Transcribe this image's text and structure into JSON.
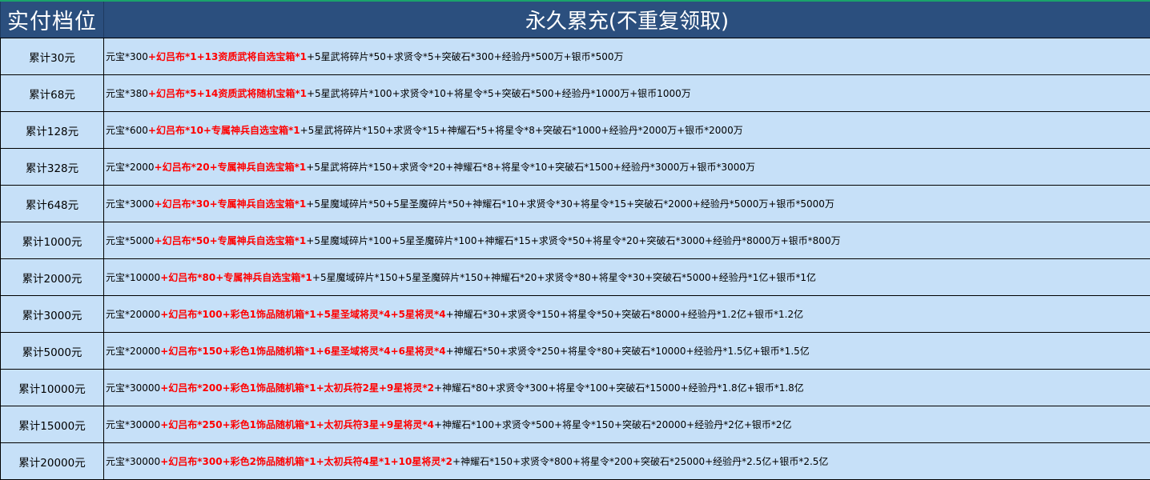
{
  "header": {
    "col_tier": "实付档位",
    "col_rewards": "永久累充(不重复领取)"
  },
  "rows": [
    {
      "tier": "累计30元",
      "base": "元宝*300",
      "highlight": "+幻吕布*1+13资质武将自选宝箱*1",
      "rest": "+5星武将碎片*50+求贤令*5+突破石*300+经验丹*500万+银币*500万"
    },
    {
      "tier": "累计68元",
      "base": "元宝*380",
      "highlight": "+幻吕布*5+14资质武将随机宝箱*1",
      "rest": "+5星武将碎片*100+求贤令*10+将星令*5+突破石*500+经验丹*1000万+银币1000万"
    },
    {
      "tier": "累计128元",
      "base": "元宝*600",
      "highlight": "+幻吕布*10+专属神兵自选宝箱*1",
      "rest": "+5星武将碎片*150+求贤令*15+神耀石*5+将星令*8+突破石*1000+经验丹*2000万+银币*2000万"
    },
    {
      "tier": "累计328元",
      "base": "元宝*2000",
      "highlight": "+幻吕布*20+专属神兵自选宝箱*1",
      "rest": "+5星武将碎片*150+求贤令*20+神耀石*8+将星令*10+突破石*1500+经验丹*3000万+银币*3000万"
    },
    {
      "tier": "累计648元",
      "base": "元宝*3000",
      "highlight": "+幻吕布*30+专属神兵自选宝箱*1",
      "rest": "+5星魔域碎片*50+5星圣魔碎片*50+神耀石*10+求贤令*30+将星令*15+突破石*2000+经验丹*5000万+银币*5000万"
    },
    {
      "tier": "累计1000元",
      "base": "元宝*5000",
      "highlight": "+幻吕布*50+专属神兵自选宝箱*1",
      "rest": "+5星魔域碎片*100+5星圣魔碎片*100+神耀石*15+求贤令*50+将星令*20+突破石*3000+经验丹*8000万+银币*800万"
    },
    {
      "tier": "累计2000元",
      "base": "元宝*10000",
      "highlight": "+幻吕布*80+专属神兵自选宝箱*1",
      "rest": "+5星魔域碎片*150+5星圣魔碎片*150+神耀石*20+求贤令*80+将星令*30+突破石*5000+经验丹*1亿+银币*1亿"
    },
    {
      "tier": "累计3000元",
      "base": "元宝*20000",
      "highlight": "+幻吕布*100+彩色1饰品随机箱*1+5星圣域将灵*4+5星将灵*4",
      "rest": "+神耀石*30+求贤令*150+将星令*50+突破石*8000+经验丹*1.2亿+银币*1.2亿"
    },
    {
      "tier": "累计5000元",
      "base": "元宝*20000",
      "highlight": "+幻吕布*150+彩色1饰品随机箱*1+6星圣域将灵*4+6星将灵*4",
      "rest": "+神耀石*50+求贤令*250+将星令*80+突破石*10000+经验丹*1.5亿+银币*1.5亿"
    },
    {
      "tier": "累计10000元",
      "base": "元宝*30000",
      "highlight": "+幻吕布*200+彩色1饰品随机箱*1+太初兵符2星+9星将灵*2",
      "rest": "+神耀石*80+求贤令*300+将星令*100+突破石*15000+经验丹*1.8亿+银币*1.8亿"
    },
    {
      "tier": "累计15000元",
      "base": "元宝*30000",
      "highlight": "+幻吕布*250+彩色1饰品随机箱*1+太初兵符3星+9星将灵*4",
      "rest": "+神耀石*100+求贤令*500+将星令*150+突破石*20000+经验丹*2亿+银币*2亿"
    },
    {
      "tier": "累计20000元",
      "base": "元宝*30000",
      "highlight": "+幻吕布*300+彩色2饰品随机箱*1+太初兵符4星*1+10星将灵*2",
      "rest": "+神耀石*150+求贤令*800+将星令*200+突破石*25000+经验丹*2.5亿+银币*2.5亿"
    }
  ]
}
